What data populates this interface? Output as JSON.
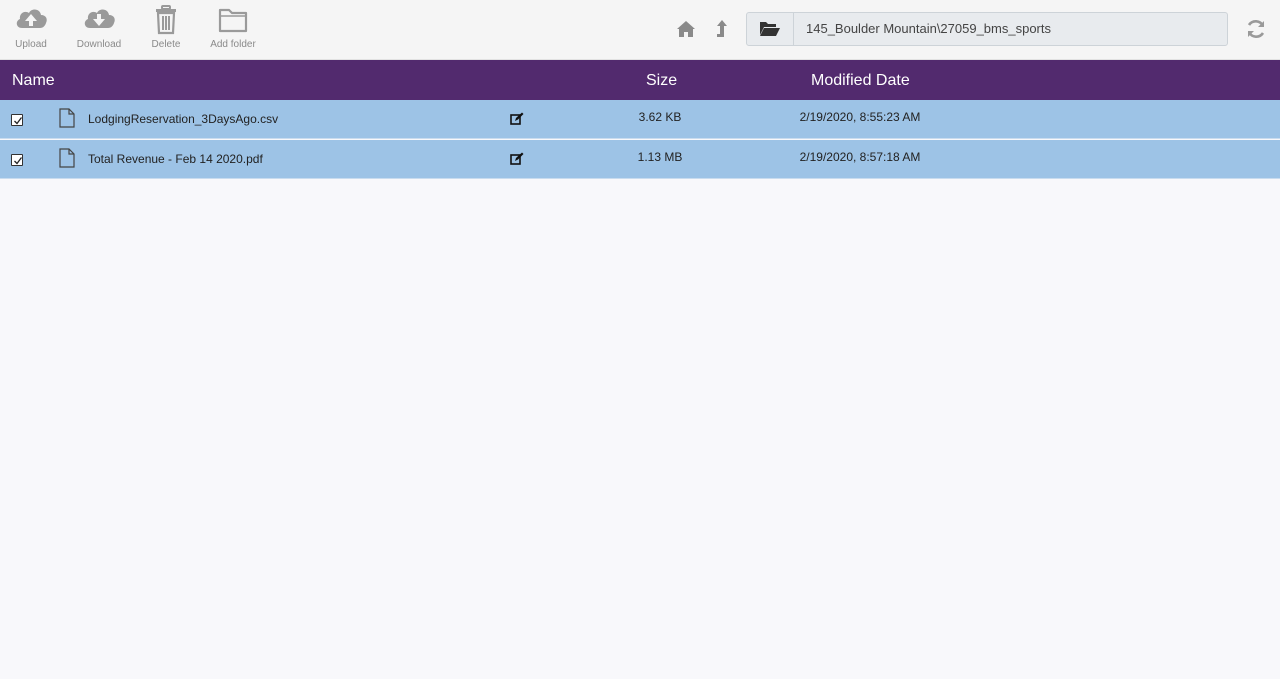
{
  "toolbar": {
    "upload_label": "Upload",
    "download_label": "Download",
    "delete_label": "Delete",
    "add_folder_label": "Add folder",
    "icon_color": "#9a9a9a"
  },
  "navigation": {
    "home_icon": "home-icon",
    "up_icon": "level-up-icon",
    "path": "145_Boulder Mountain\\27059_bms_sports",
    "refresh_icon": "refresh-icon"
  },
  "table": {
    "header_color": "#522a6e",
    "selected_row_color": "#9dc3e6",
    "columns": {
      "name": "Name",
      "size": "Size",
      "modified": "Modified Date"
    },
    "rows": [
      {
        "checked": true,
        "name": "LodgingReservation_3DaysAgo.csv",
        "size": "3.62 KB",
        "modified": "2/19/2020, 8:55:23 AM"
      },
      {
        "checked": true,
        "name": "Total Revenue - Feb 14 2020.pdf",
        "size": "1.13 MB",
        "modified": "2/19/2020, 8:57:18 AM"
      }
    ]
  }
}
